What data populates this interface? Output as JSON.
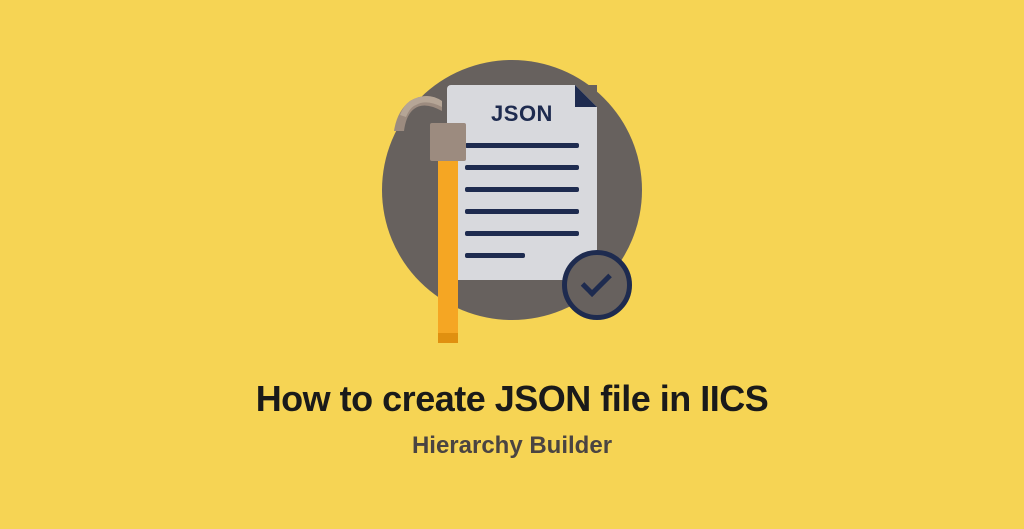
{
  "graphic": {
    "json_label": "JSON"
  },
  "title": "How to create JSON file in IICS",
  "subtitle": "Hierarchy Builder"
}
